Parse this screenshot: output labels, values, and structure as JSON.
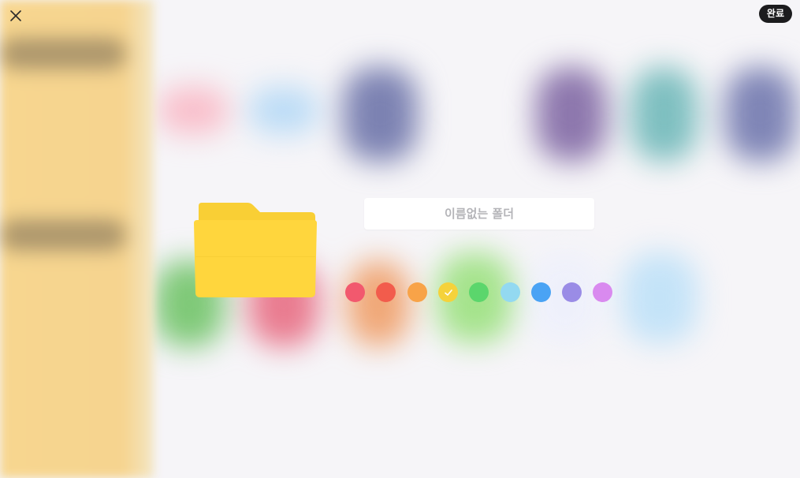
{
  "header": {
    "close_icon": "close-icon",
    "done_label": "완료"
  },
  "folder": {
    "icon": "folder-icon",
    "color": "#ffd63d"
  },
  "name_input": {
    "value": "",
    "placeholder": "이름없는 폴더"
  },
  "colors": {
    "selected_index": 3,
    "options": [
      {
        "name": "pink-red",
        "hex": "#f2596e"
      },
      {
        "name": "red",
        "hex": "#f25c4c"
      },
      {
        "name": "orange",
        "hex": "#f8a348"
      },
      {
        "name": "yellow",
        "hex": "#f5d23b"
      },
      {
        "name": "green",
        "hex": "#5bd66c"
      },
      {
        "name": "light-blue",
        "hex": "#93d9f1"
      },
      {
        "name": "blue",
        "hex": "#4aa3f4"
      },
      {
        "name": "purple",
        "hex": "#9a8ce6"
      },
      {
        "name": "violet",
        "hex": "#d98aef"
      }
    ]
  }
}
